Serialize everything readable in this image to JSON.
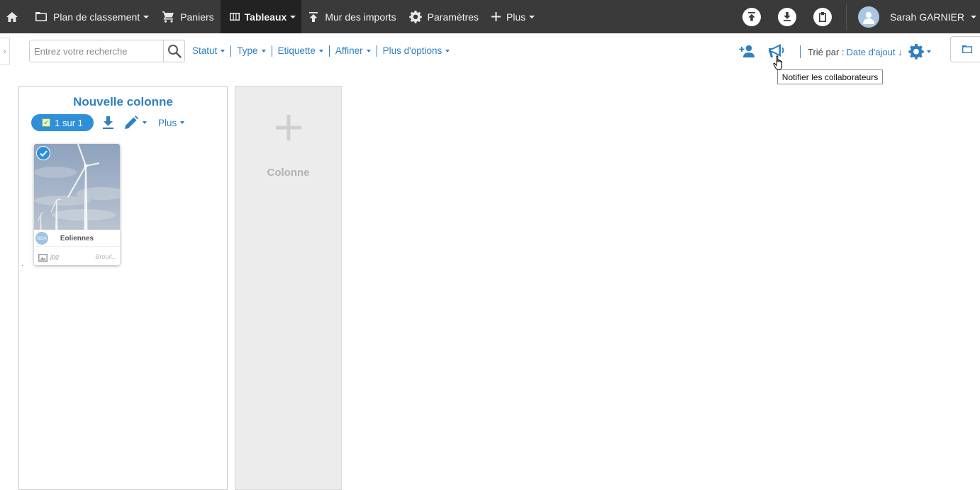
{
  "topnav": {
    "items": [
      {
        "label": "",
        "icon": "home-icon"
      },
      {
        "label": "Plan de classement",
        "icon": "folder-icon",
        "dropdown": true
      },
      {
        "label": "Paniers",
        "icon": "cart-icon"
      },
      {
        "label": "Tableaux",
        "icon": "columns-icon",
        "dropdown": true,
        "active": true
      },
      {
        "label": "Mur des imports",
        "icon": "upload-arrow-icon"
      },
      {
        "label": "Paramètres",
        "icon": "gear-icon"
      },
      {
        "label": "Plus",
        "icon": "plus-icon",
        "dropdown": true
      }
    ],
    "actions": [
      "upload-icon",
      "download-icon",
      "clipboard-icon"
    ],
    "user": {
      "name": "Sarah GARNIER",
      "avatar": "user-avatar-icon"
    }
  },
  "toolbar": {
    "search": {
      "placeholder": "Entrez votre recherche",
      "value": ""
    },
    "filters": [
      "Statut",
      "Type",
      "Etiquette",
      "Affiner",
      "Plus d'options"
    ],
    "sort": {
      "label": "Trié par :",
      "value": "Date d'ajout ↓"
    },
    "icons": [
      "add-user-icon",
      "megaphone-icon",
      "settings-gear-icon",
      "folder-outline-icon"
    ],
    "tooltip": "Notifier les collaborateurs"
  },
  "board": {
    "column": {
      "title": "Nouvelle colonne",
      "count_label": "1 sur 1",
      "more_label": "Plus",
      "cards": [
        {
          "title": "Eoliennes",
          "owner": "SGA",
          "ext": "jpg",
          "status": "Brouil...",
          "selected": true
        }
      ]
    },
    "add_column": {
      "label": "Colonne"
    }
  },
  "colors": {
    "accent": "#2f7fc1",
    "navbar": "#3a3a3a",
    "pill": "#2f8fd8"
  }
}
